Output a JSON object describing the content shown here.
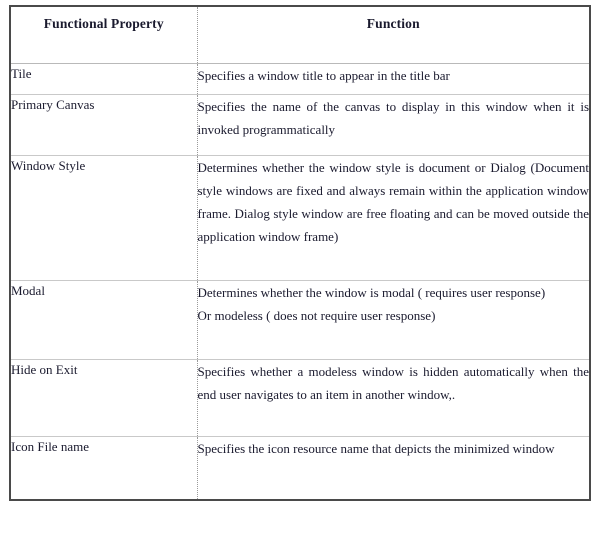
{
  "table": {
    "columns": [
      {
        "key": "property",
        "label": "Functional Property"
      },
      {
        "key": "function",
        "label": "Function"
      }
    ],
    "rows": [
      {
        "property": "Tile",
        "function_lines": [
          "Specifies a window title to appear in the title bar"
        ]
      },
      {
        "property": "Primary Canvas",
        "function_lines": [
          "Specifies the name of the canvas to display in this window when it is invoked programmatically"
        ]
      },
      {
        "property": "Window Style",
        "function_lines": [
          "Determines whether the window style is document or Dialog (Document style windows are fixed and always remain within the application window frame.  Dialog style window are free floating and can be moved outside the application window frame)"
        ]
      },
      {
        "property": "Modal",
        "function_lines": [
          "Determines whether the window is modal ( requires user response)",
          "Or modeless ( does not require user response)"
        ]
      },
      {
        "property": "Hide on Exit",
        "function_lines": [
          "Specifies whether a modeless window is hidden automatically when the end user navigates to an item in another window,."
        ]
      },
      {
        "property": "Icon File name",
        "function_lines": [
          "Specifies the icon resource name that depicts the minimized window"
        ]
      }
    ]
  },
  "style": {
    "text_color": "#1a1a2e",
    "border_color": "#4a4a4a",
    "rule_color": "#c9c9c9",
    "divider_color": "#9a9a9a",
    "background": "#ffffff"
  }
}
